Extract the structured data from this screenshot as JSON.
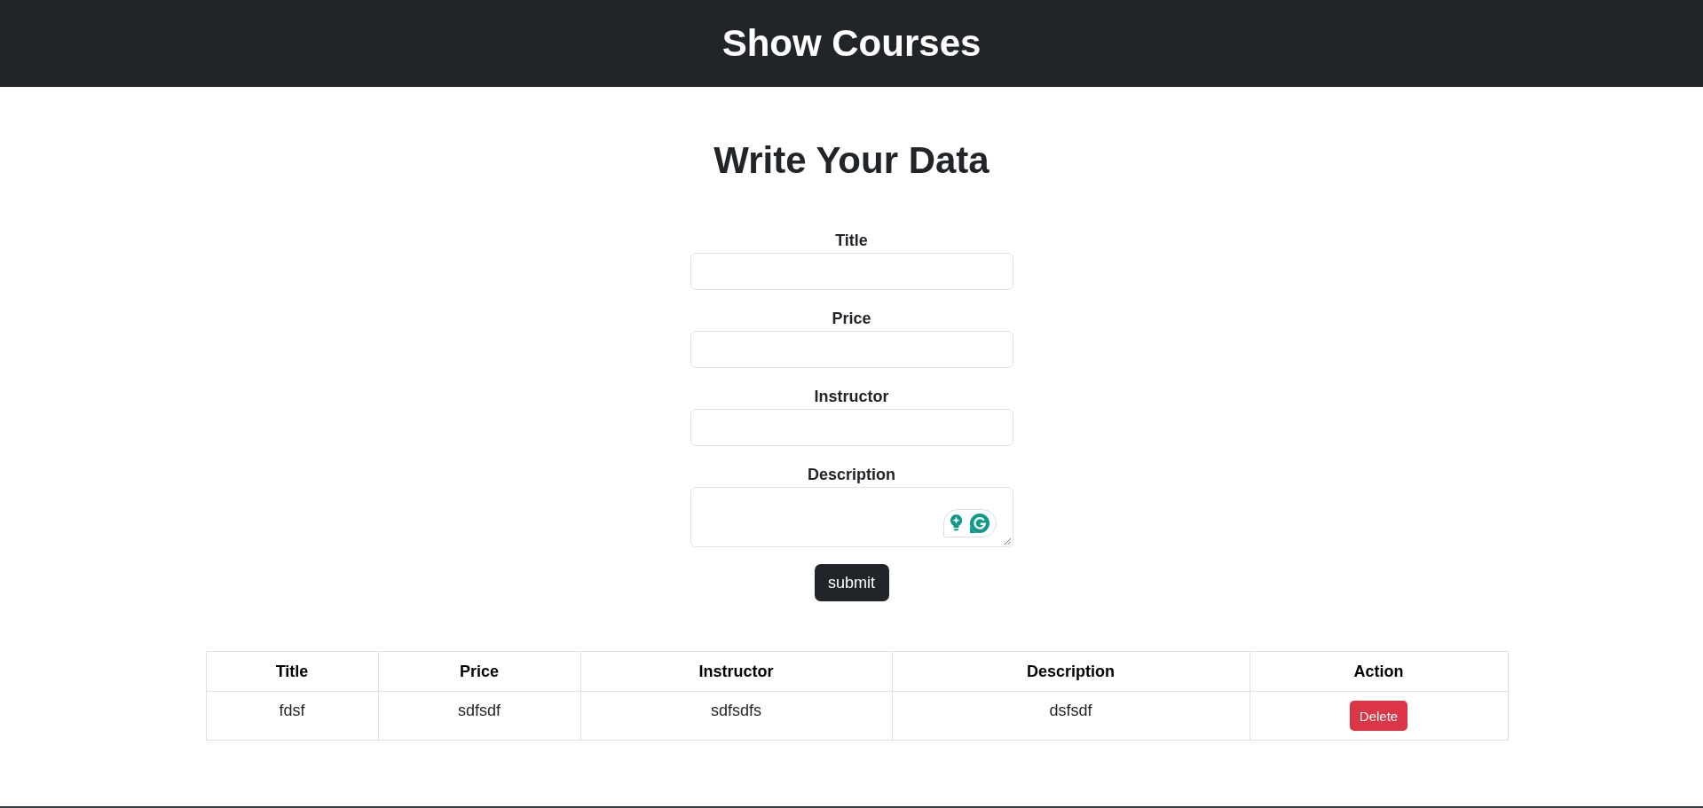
{
  "header": {
    "title": "Show Courses"
  },
  "form": {
    "heading": "Write Your Data",
    "fields": [
      {
        "label": "Title",
        "kind": "input"
      },
      {
        "label": "Price",
        "kind": "input"
      },
      {
        "label": "Instructor",
        "kind": "input"
      },
      {
        "label": "Description",
        "kind": "textarea"
      }
    ],
    "submit": "submit"
  },
  "table": {
    "columns": [
      "Title",
      "Price",
      "Instructor",
      "Description",
      "Action"
    ],
    "rows": [
      {
        "cells": [
          {
            "kind": "text",
            "text": "fdsf"
          },
          {
            "kind": "text",
            "text": "sdfsdf"
          },
          {
            "kind": "text",
            "text": "sdfsdfs"
          },
          {
            "kind": "text",
            "text": "dsfsdf"
          },
          {
            "kind": "button",
            "text": "Delete"
          }
        ]
      }
    ]
  }
}
